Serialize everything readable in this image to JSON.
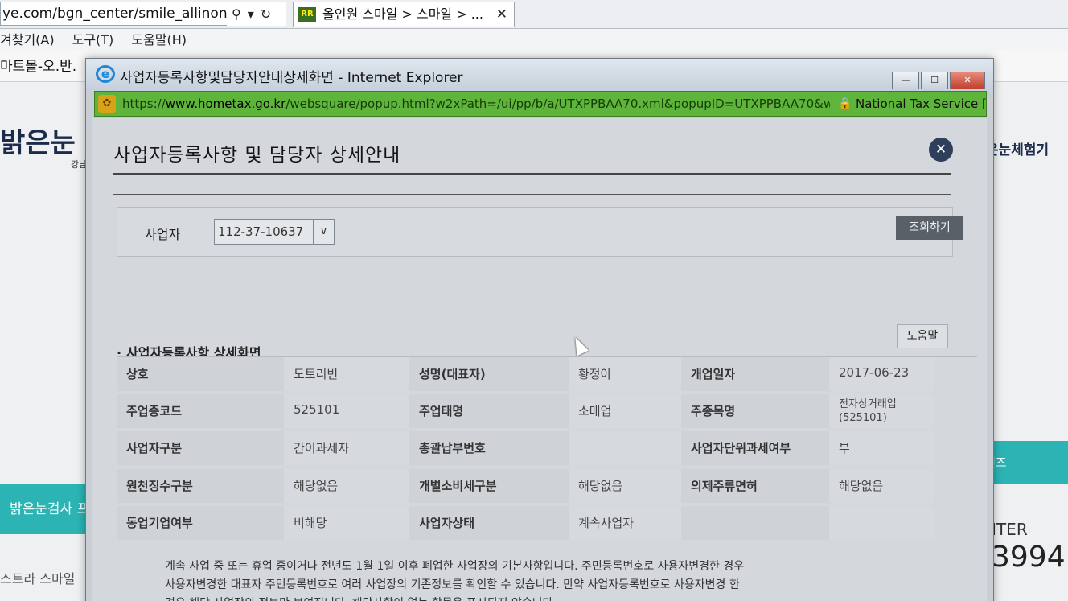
{
  "background_browser": {
    "url": "ye.com/bgn_center/smile_allinone.",
    "tab_title": "올인원 스마일 > 스마일 > ...",
    "tab_favicon_text": "RR",
    "menu": [
      "겨찾기(A)",
      "도구(T)",
      "도움말(H)"
    ],
    "favorites_bar_text": "마트몰-오.반.",
    "logo": "밝은눈",
    "logo_sub": "강남",
    "right_nav": "은눈체험기",
    "teal_band_text": "밝은눈검사 프",
    "left_footer": "스트라 스마일",
    "right_teal_text": "렌즈",
    "right_center": "NTER",
    "right_phone": "-3994"
  },
  "popup": {
    "window_title": "사업자등록사항및담당자안내상세화면 - Internet Explorer",
    "url": {
      "prefix": "https://",
      "host": "www.hometax.go.kr",
      "path": "/websquare/popup.html?w2xPath=/ui/pp/b/a/UTXPPBAA70.xml&popupID=UTXPPBAA70&w",
      "owner": "National Tax Service [KR]"
    },
    "window_buttons": {
      "minimize": "—",
      "maximize": "☐",
      "close": "✕"
    },
    "page_title": "사업자등록사항 및 담당자 상세안내",
    "close_symbol": "✕",
    "search": {
      "label": "사업자",
      "selected": "112-37-10637",
      "arrow": "∨",
      "query_button": "조회하기"
    },
    "help_button": "도움말",
    "section_title": "사업자등록사항 상세화면",
    "details": {
      "rows": [
        [
          {
            "label": "상호",
            "value": "도토리빈"
          },
          {
            "label": "성명(대표자)",
            "value": "황정아"
          },
          {
            "label": "개업일자",
            "value": "2017-06-23"
          }
        ],
        [
          {
            "label": "주업종코드",
            "value": "525101"
          },
          {
            "label": "주업태명",
            "value": "소매업"
          },
          {
            "label": "주종목명",
            "value": "전자상거래업(525101)"
          }
        ],
        [
          {
            "label": "사업자구분",
            "value": "간이과세자"
          },
          {
            "label": "총괄납부번호",
            "value": ""
          },
          {
            "label": "사업자단위과세여부",
            "value": "부"
          }
        ],
        [
          {
            "label": "원천징수구분",
            "value": "해당없음"
          },
          {
            "label": "개별소비세구분",
            "value": "해당없음"
          },
          {
            "label": "의제주류면허",
            "value": "해당없음"
          }
        ],
        [
          {
            "label": "동업기업여부",
            "value": "비해당"
          },
          {
            "label": "사업자상태",
            "value": "계속사업자"
          },
          {
            "label": "",
            "value": ""
          }
        ]
      ]
    },
    "notice": [
      "계속 사업 중 또는 휴업 중이거나 전년도 1월 1일 이후 폐업한 사업장의 기본사항입니다. 주민등록번호로 사용자변경한 경우",
      "사용자변경한 대표자 주민등록번호로 여러 사업장의 기존정보를 확인할 수 있습니다. 만약 사업자등록번호로 사용자변경 한",
      "경우 해당 사업장의 정보만 보여집니다. 해당사항이 없는 항목은 표시되지 않습니다."
    ]
  }
}
